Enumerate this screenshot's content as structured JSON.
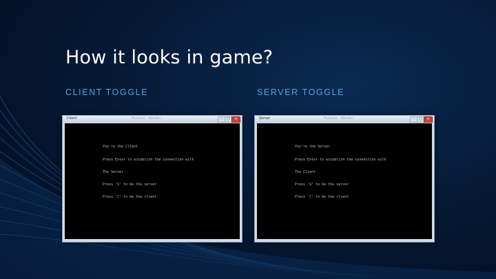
{
  "slide": {
    "title": "How it looks in game?"
  },
  "columns": [
    {
      "heading": "CLIENT TOGGLE",
      "window": {
        "title": "Client",
        "center_title": "Pictures · Render",
        "min_glyph": "–",
        "max_glyph": "□",
        "close_glyph": "✕",
        "lines": [
          "You're the Client",
          "Press Enter to establish the connection with",
          "The Server",
          "Press 'S' to be the server",
          "Press 'C' to be the client"
        ]
      }
    },
    {
      "heading": "SERVER TOGGLE",
      "window": {
        "title": "Server",
        "center_title": "Pictures · Render",
        "min_glyph": "–",
        "max_glyph": "□",
        "close_glyph": "✕",
        "lines": [
          "You're the Server",
          "Press Enter to establish the connection with",
          "The Client",
          "Press 'S' to be the server",
          "Press 'C' to be the client"
        ]
      }
    }
  ],
  "colors": {
    "accent": "#49a6e6",
    "background": "#061a36",
    "console_bg": "#000000",
    "console_text": "#bdbdbd"
  }
}
